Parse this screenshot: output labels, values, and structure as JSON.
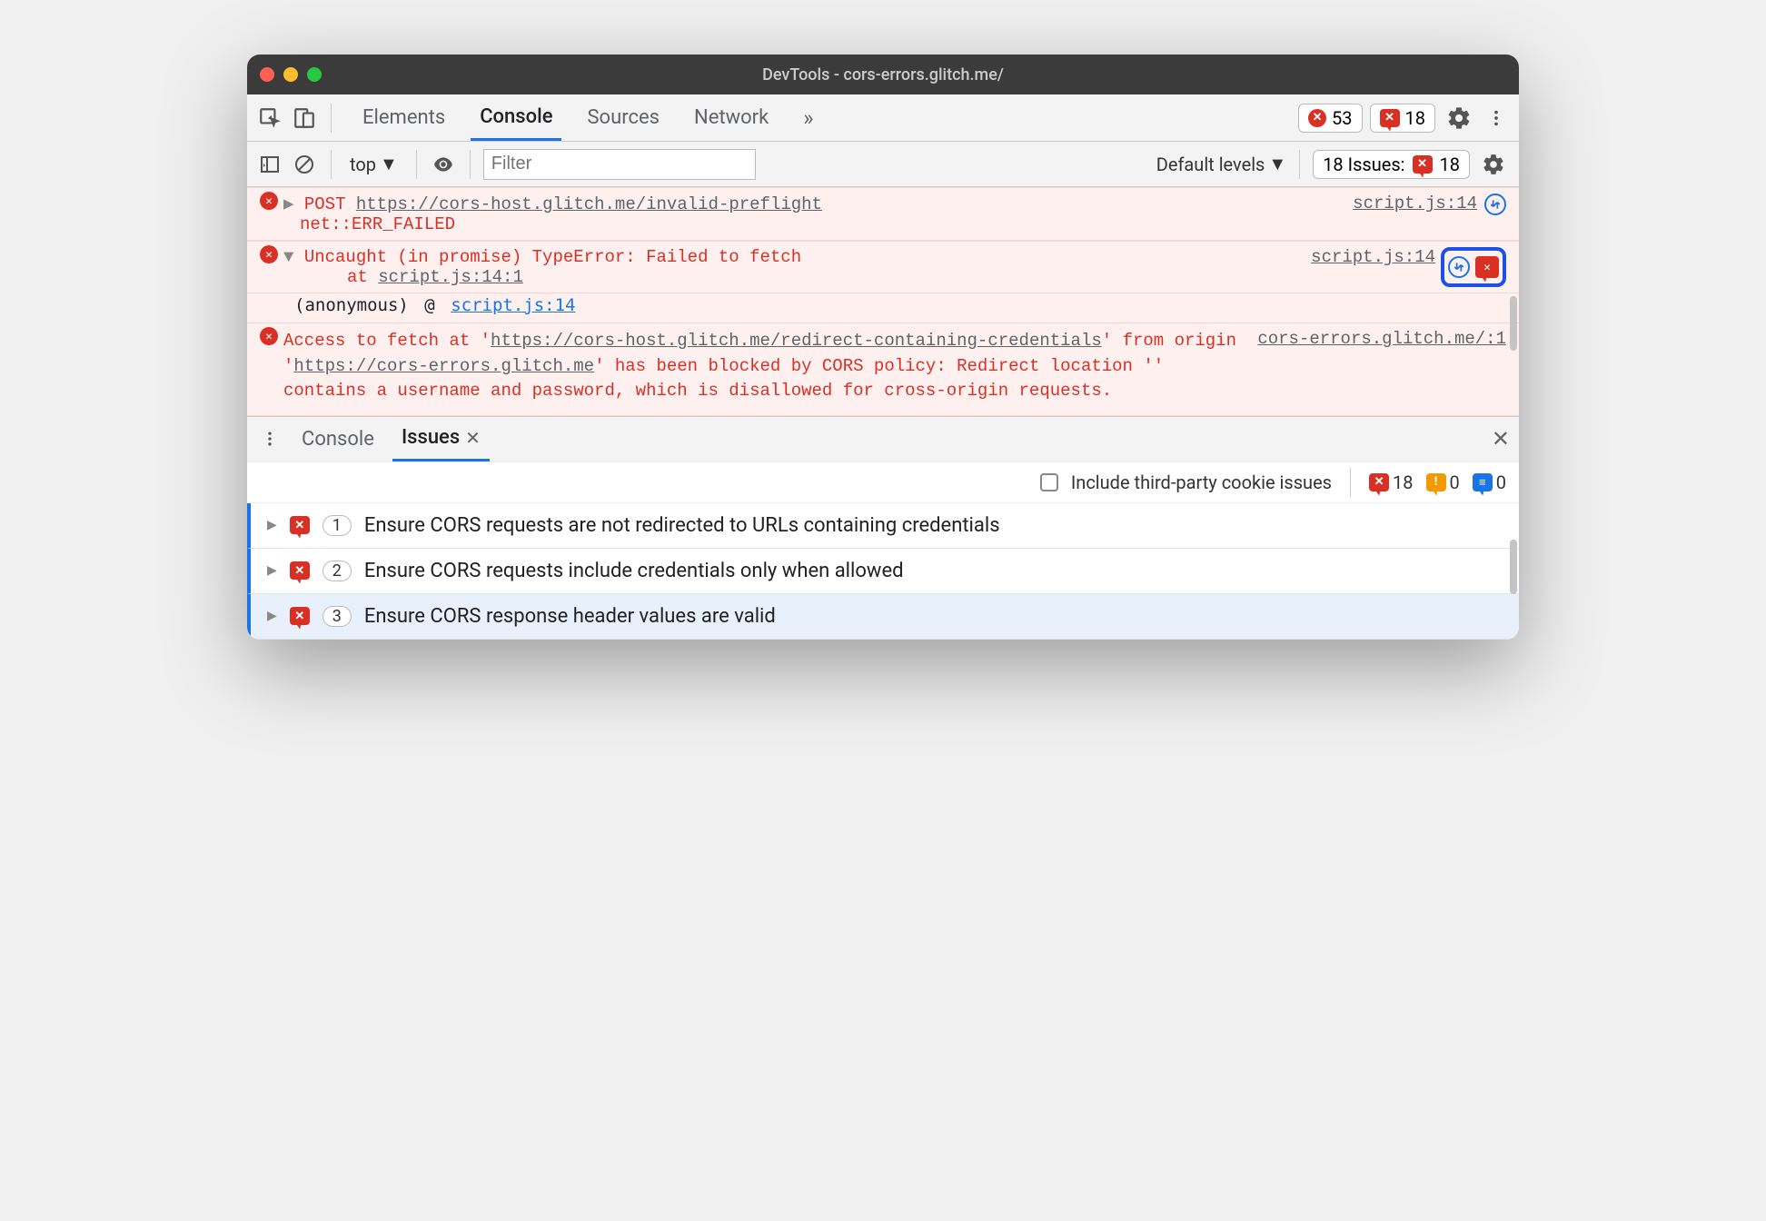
{
  "window_title": "DevTools - cors-errors.glitch.me/",
  "main_tabs": [
    "Elements",
    "Console",
    "Sources",
    "Network"
  ],
  "active_main_tab": "Console",
  "more_tabs_glyph": "»",
  "error_count": "53",
  "issue_count_top": "18",
  "console_toolbar": {
    "context": "top",
    "filter_placeholder": "Filter",
    "levels_label": "Default levels",
    "issues_label": "18 Issues:",
    "issues_badge": "18"
  },
  "logs": [
    {
      "disclosure": "▶",
      "method": "POST",
      "url": "https://cors-host.glitch.me/invalid-preflight",
      "err": "net::ERR_FAILED",
      "source": "script.js:14"
    },
    {
      "disclosure": "▼",
      "message": "Uncaught (in promise) TypeError: Failed to fetch",
      "stack_at": "at ",
      "stack_loc": "script.js:14:1",
      "anon_label": "(anonymous)",
      "anon_at": "@",
      "anon_loc": "script.js:14",
      "source": "script.js:14"
    },
    {
      "pre": "Access to fetch at '",
      "url1": "https://cors-host.glitch.me/redirect-containing-credentials",
      "mid1": "' from origin '",
      "url2": "https://cors-errors.glitch.me",
      "post": "' has been blocked by CORS policy: Redirect location '' contains a username and password, which is disallowed for cross-origin requests.",
      "source": "cors-errors.glitch.me/:1"
    }
  ],
  "drawer": {
    "tabs": [
      "Console",
      "Issues"
    ],
    "active": "Issues",
    "third_party_label": "Include third-party cookie issues",
    "counts": {
      "error": "18",
      "warning": "0",
      "info": "0"
    },
    "issues": [
      {
        "count": "1",
        "title": "Ensure CORS requests are not redirected to URLs containing credentials"
      },
      {
        "count": "2",
        "title": "Ensure CORS requests include credentials only when allowed"
      },
      {
        "count": "3",
        "title": "Ensure CORS response header values are valid"
      }
    ]
  }
}
